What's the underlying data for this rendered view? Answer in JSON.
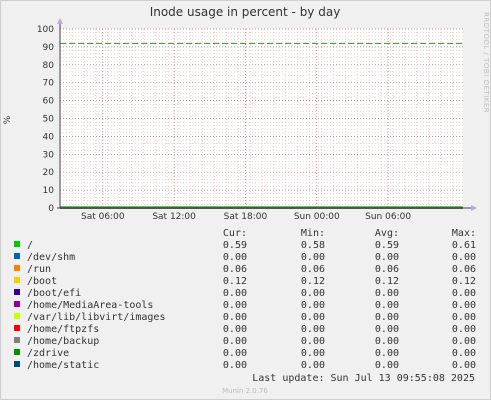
{
  "colors": {
    "background": "#f0f0f0",
    "plot_background": "#ffffff",
    "grid_major": "#e06060",
    "grid_minor": "#f0b0b0",
    "warning_line": "#2f8f2f",
    "axis": "#444444"
  },
  "side_label": "RRDTOOL / TOBI OETIKER",
  "footer": {
    "last_update": "Last update: Sun Jul 13 09:55:08 2025",
    "version": "Munin 2.0.76"
  },
  "legend": {
    "headers": [
      "Cur:",
      "Min:",
      "Avg:",
      "Max:"
    ],
    "rows": [
      {
        "name": "/",
        "color": "#00cc00",
        "cur": "0.59",
        "min": "0.58",
        "avg": "0.59",
        "max": "0.61"
      },
      {
        "name": "/dev/shm",
        "color": "#0066b3",
        "cur": "0.00",
        "min": "0.00",
        "avg": "0.00",
        "max": "0.00"
      },
      {
        "name": "/run",
        "color": "#ff8000",
        "cur": "0.06",
        "min": "0.06",
        "avg": "0.06",
        "max": "0.06"
      },
      {
        "name": "/boot",
        "color": "#ffcc00",
        "cur": "0.12",
        "min": "0.12",
        "avg": "0.12",
        "max": "0.12"
      },
      {
        "name": "/boot/efi",
        "color": "#330099",
        "cur": "0.00",
        "min": "0.00",
        "avg": "0.00",
        "max": "0.00"
      },
      {
        "name": "/home/MediaArea-tools",
        "color": "#990099",
        "cur": "0.00",
        "min": "0.00",
        "avg": "0.00",
        "max": "0.00"
      },
      {
        "name": "/var/lib/libvirt/images",
        "color": "#ccff00",
        "cur": "0.00",
        "min": "0.00",
        "avg": "0.00",
        "max": "0.00"
      },
      {
        "name": "/home/ftpzfs",
        "color": "#ff0000",
        "cur": "0.00",
        "min": "0.00",
        "avg": "0.00",
        "max": "0.00"
      },
      {
        "name": "/home/backup",
        "color": "#808080",
        "cur": "0.00",
        "min": "0.00",
        "avg": "0.00",
        "max": "0.00"
      },
      {
        "name": "/zdrive",
        "color": "#008f00",
        "cur": "0.00",
        "min": "0.00",
        "avg": "0.00",
        "max": "0.00"
      },
      {
        "name": "/home/static",
        "color": "#00487d",
        "cur": "0.00",
        "min": "0.00",
        "avg": "0.00",
        "max": "0.00"
      }
    ]
  },
  "chart_data": {
    "type": "line",
    "title": "Inode usage in percent - by day",
    "ylabel": "%",
    "xlabel": "",
    "ylim": [
      0,
      100
    ],
    "yticks": [
      0,
      10,
      20,
      30,
      40,
      50,
      60,
      70,
      80,
      90,
      100
    ],
    "x_range_hours": [
      0,
      33.9
    ],
    "xticks": [
      {
        "label": "Sat 06:00",
        "hour": 3.6
      },
      {
        "label": "Sat 12:00",
        "hour": 9.6
      },
      {
        "label": "Sat 18:00",
        "hour": 15.6
      },
      {
        "label": "Sun 00:00",
        "hour": 21.6
      },
      {
        "label": "Sun 06:00",
        "hour": 27.6
      }
    ],
    "warning_level": 92,
    "grid": true,
    "series": [
      {
        "name": "/",
        "values": [
          0.59,
          0.59
        ]
      },
      {
        "name": "/dev/shm",
        "values": [
          0.0,
          0.0
        ]
      },
      {
        "name": "/run",
        "values": [
          0.06,
          0.06
        ]
      },
      {
        "name": "/boot",
        "values": [
          0.12,
          0.12
        ]
      },
      {
        "name": "/boot/efi",
        "values": [
          0.0,
          0.0
        ]
      },
      {
        "name": "/home/MediaArea-tools",
        "values": [
          0.0,
          0.0
        ]
      },
      {
        "name": "/var/lib/libvirt/images",
        "values": [
          0.0,
          0.0
        ]
      },
      {
        "name": "/home/ftpzfs",
        "values": [
          0.0,
          0.0
        ]
      },
      {
        "name": "/home/backup",
        "values": [
          0.0,
          0.0
        ]
      },
      {
        "name": "/zdrive",
        "values": [
          0.0,
          0.0
        ]
      },
      {
        "name": "/home/static",
        "values": [
          0.0,
          0.0
        ]
      }
    ]
  }
}
